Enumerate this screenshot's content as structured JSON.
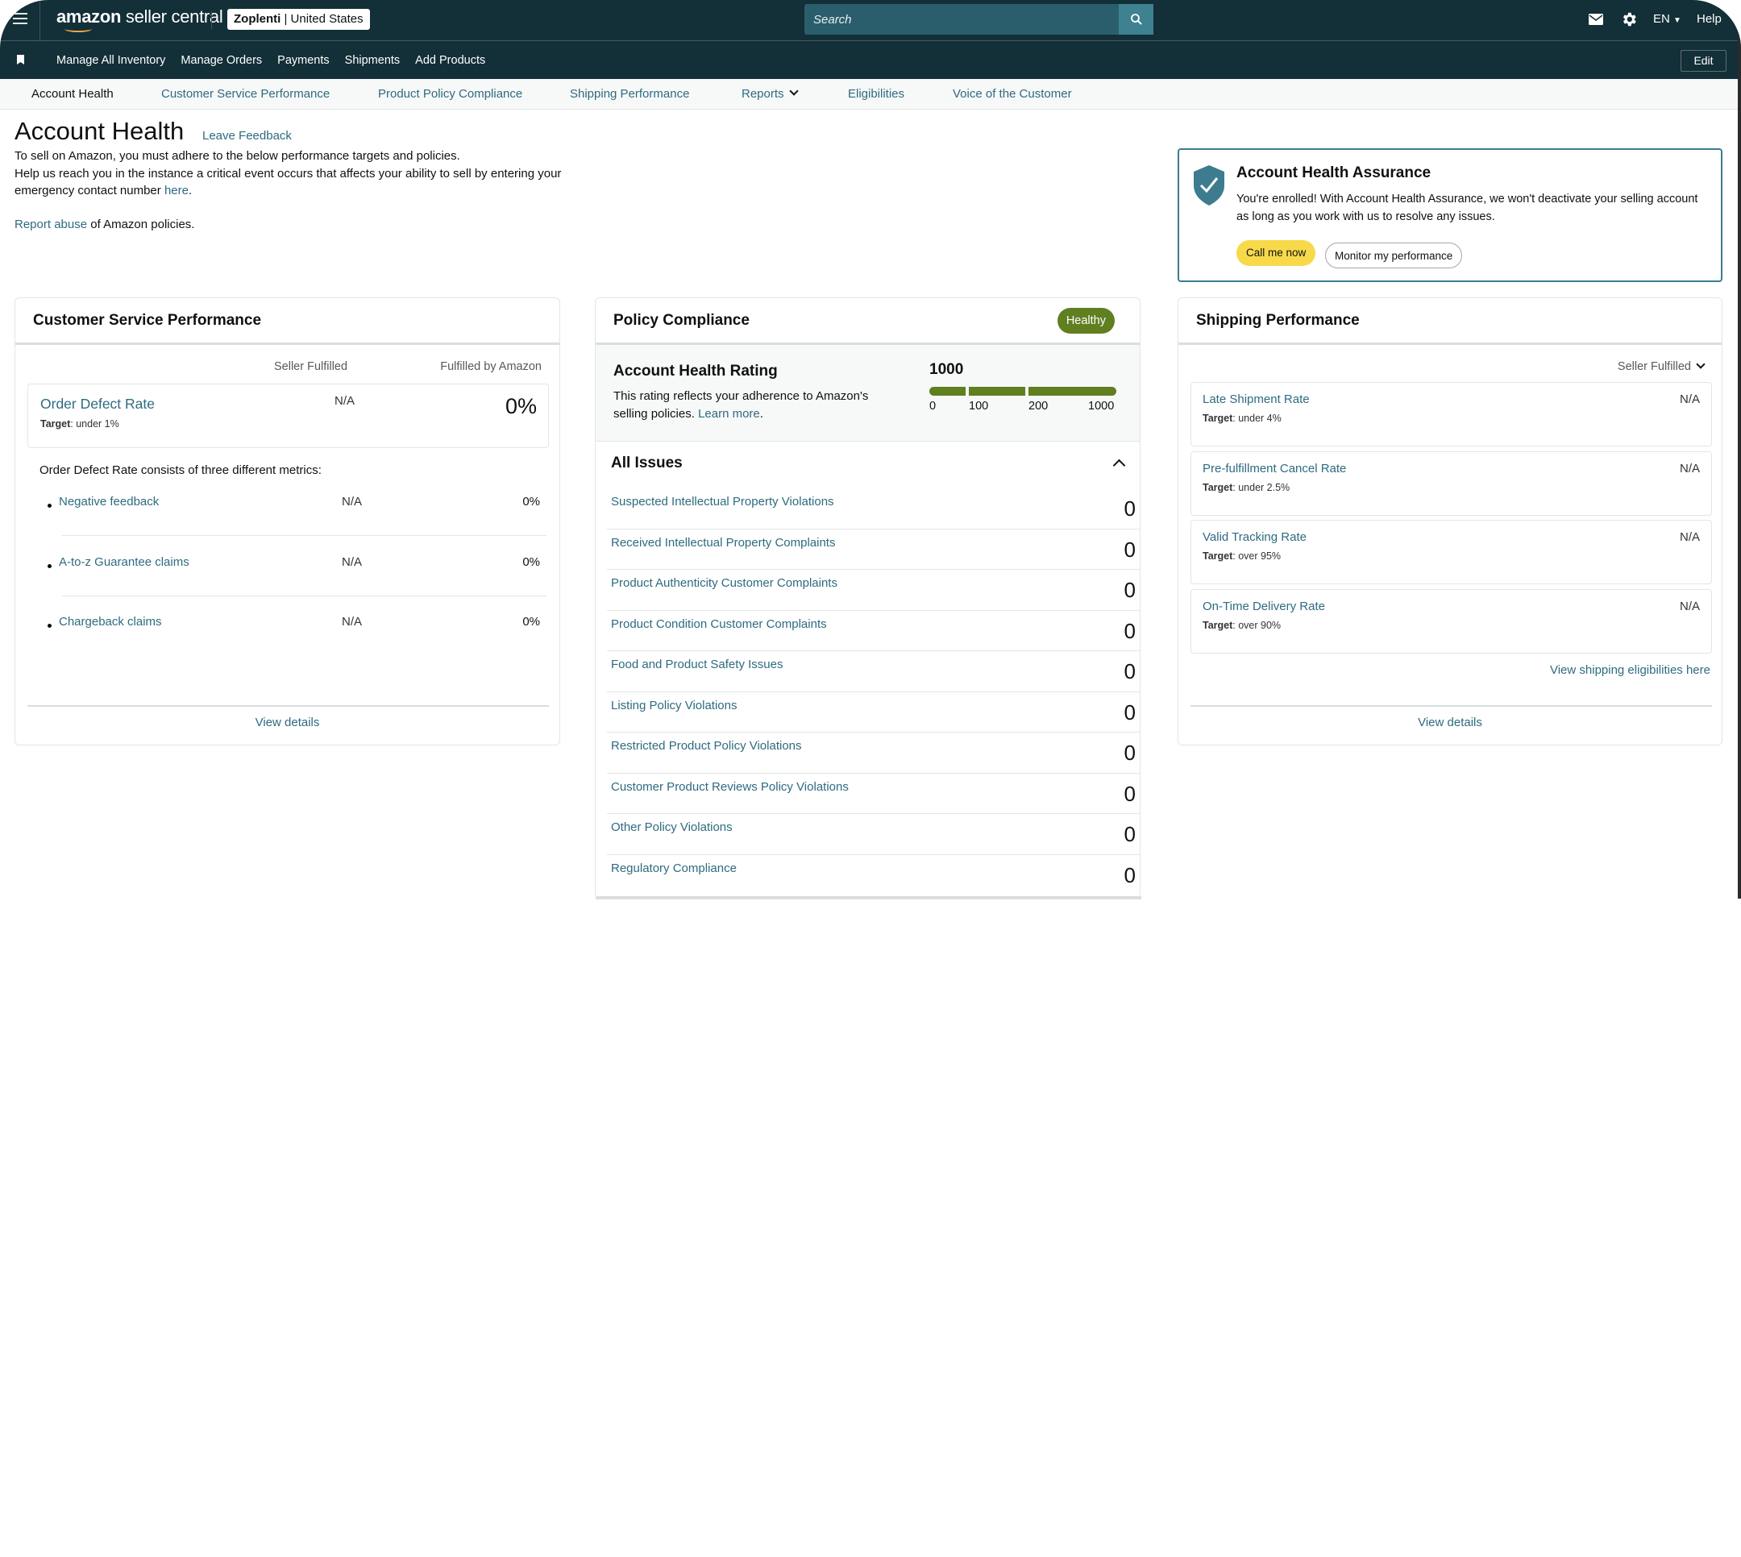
{
  "topbar": {
    "logo_bold": "amazon",
    "logo_light": " seller central",
    "account_name": "Zoplenti",
    "account_region": " | United States",
    "search_placeholder": "Search",
    "language": "EN",
    "help": "Help"
  },
  "navbar": {
    "links": [
      "Manage All Inventory",
      "Manage Orders",
      "Payments",
      "Shipments",
      "Add Products"
    ],
    "edit": "Edit"
  },
  "tabs": [
    {
      "label": "Account Health",
      "active": true
    },
    {
      "label": "Customer Service Performance"
    },
    {
      "label": "Product Policy Compliance"
    },
    {
      "label": "Shipping Performance"
    },
    {
      "label": "Reports",
      "dropdown": true
    },
    {
      "label": "Eligibilities"
    },
    {
      "label": "Voice of the Customer"
    }
  ],
  "header": {
    "title": "Account Health",
    "leave_feedback": "Leave Feedback",
    "intro_line1": "To sell on Amazon, you must adhere to the below performance targets and policies.",
    "intro_line2": "Help us reach you in the instance a critical event occurs that affects your ability to sell by entering your emergency contact number ",
    "intro_link": "here",
    "intro_end": ".",
    "report_abuse_link": "Report abuse",
    "report_abuse_text": " of Amazon policies."
  },
  "aha": {
    "title": "Account Health Assurance",
    "text": "You're enrolled! With Account Health Assurance, we won't deactivate your selling account as long as you work with us to resolve any issues.",
    "call_button": "Call me now",
    "monitor_button": "Monitor my performance"
  },
  "csp": {
    "title": "Customer Service Performance",
    "col_seller": "Seller Fulfilled",
    "col_fba": "Fulfilled by Amazon",
    "odr": {
      "name": "Order Defect Rate",
      "target_label": "Target",
      "target_value": ": under 1%",
      "seller": "N/A",
      "fba": "0%"
    },
    "note": "Order Defect Rate consists of three different metrics:",
    "metrics": [
      {
        "name": "Negative feedback",
        "seller": "N/A",
        "fba": "0%"
      },
      {
        "name": "A-to-z Guarantee claims",
        "seller": "N/A",
        "fba": "0%"
      },
      {
        "name": "Chargeback claims",
        "seller": "N/A",
        "fba": "0%"
      }
    ],
    "view_details": "View details"
  },
  "policy": {
    "title": "Policy Compliance",
    "status": "Healthy",
    "status_color": "#5f7f21",
    "rating_title": "Account Health Rating",
    "rating_text": "This rating reflects your adherence to Amazon's selling policies. ",
    "learn_more": "Learn more",
    "learn_more_end": ".",
    "score": "1000",
    "scale_ticks": [
      "0",
      "100",
      "200",
      "1000"
    ],
    "issues_title": "All Issues",
    "issues": [
      {
        "name": "Suspected Intellectual Property Violations",
        "count": "0"
      },
      {
        "name": "Received Intellectual Property Complaints",
        "count": "0"
      },
      {
        "name": "Product Authenticity Customer Complaints",
        "count": "0"
      },
      {
        "name": "Product Condition Customer Complaints",
        "count": "0"
      },
      {
        "name": "Food and Product Safety Issues",
        "count": "0"
      },
      {
        "name": "Listing Policy Violations",
        "count": "0"
      },
      {
        "name": "Restricted Product Policy Violations",
        "count": "0"
      },
      {
        "name": "Customer Product Reviews Policy Violations",
        "count": "0"
      },
      {
        "name": "Other Policy Violations",
        "count": "0"
      },
      {
        "name": "Regulatory Compliance",
        "count": "0"
      }
    ]
  },
  "shipping": {
    "title": "Shipping Performance",
    "filter": "Seller Fulfilled",
    "metrics": [
      {
        "name": "Late Shipment Rate",
        "target_label": "Target",
        "target_value": ": under 4%",
        "value": "N/A"
      },
      {
        "name": "Pre-fulfillment Cancel Rate",
        "target_label": "Target",
        "target_value": ": under 2.5%",
        "value": "N/A"
      },
      {
        "name": "Valid Tracking Rate",
        "target_label": "Target",
        "target_value": ": over 95%",
        "value": "N/A"
      },
      {
        "name": "On-Time Delivery Rate",
        "target_label": "Target",
        "target_value": ": over 90%",
        "value": "N/A"
      }
    ],
    "eligibilities_link": "View shipping eligibilities here",
    "view_details": "View details"
  }
}
